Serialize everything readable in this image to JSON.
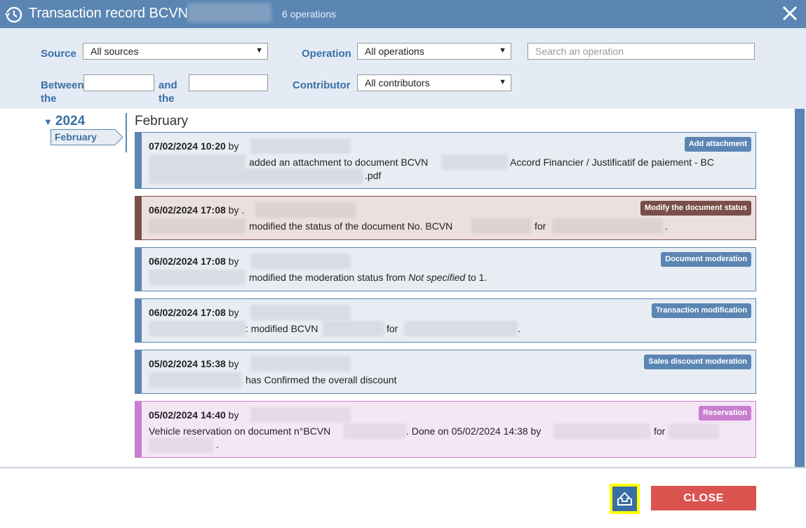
{
  "window": {
    "title": "Transaction record BCVN",
    "operations_count": "6 operations"
  },
  "filters": {
    "source_label": "Source",
    "source_value": "All sources",
    "operation_label": "Operation",
    "operation_value": "All operations",
    "search_placeholder": "Search an operation",
    "between_label": "Between the",
    "and_label": "and the",
    "contributor_label": "Contributor",
    "contributor_value": "All contributors"
  },
  "timeline": {
    "year": "2024",
    "month_chip": "February",
    "month_heading": "February"
  },
  "entries": [
    {
      "datetime": "07/02/2024 10:20",
      "by": "by",
      "badge": "Add attachment",
      "badge_color": "#5b86b3",
      "text1": "added an attachment to document BCVN",
      "text2": "Accord Financier / Justificatif de paiement - BC",
      "text3": ".pdf"
    },
    {
      "datetime": "06/02/2024 17:08",
      "by": "by .",
      "badge": "Modify the document status",
      "badge_color": "#7a4f4a",
      "text1": "modified the status of the document No. BCVN",
      "text2": "for",
      "text3": "."
    },
    {
      "datetime": "06/02/2024 17:08",
      "by": "by",
      "badge": "Document moderation",
      "badge_color": "#5b86b3",
      "text1": "modified the moderation status from",
      "text1_em": "Not specified",
      "text1_tail": "to 1."
    },
    {
      "datetime": "06/02/2024 17:08",
      "by": "by",
      "badge": "Transaction modification",
      "badge_color": "#5b86b3",
      "text1": ": modified BCVN",
      "text2": "for",
      "text3": "."
    },
    {
      "datetime": "05/02/2024 15:38",
      "by": "by",
      "badge": "Sales discount moderation",
      "badge_color": "#5b86b3",
      "text1": "has Confirmed the overall discount"
    },
    {
      "datetime": "05/02/2024 14:40",
      "by": "by",
      "badge": "Reservation",
      "badge_color": "#c97fcf",
      "text1": "Vehicle reservation on document n°BCVN",
      "text2": ". Done on 05/02/2024 14:38 by",
      "text3": "for",
      "text4": "."
    }
  ],
  "footer": {
    "close_label": "CLOSE"
  }
}
